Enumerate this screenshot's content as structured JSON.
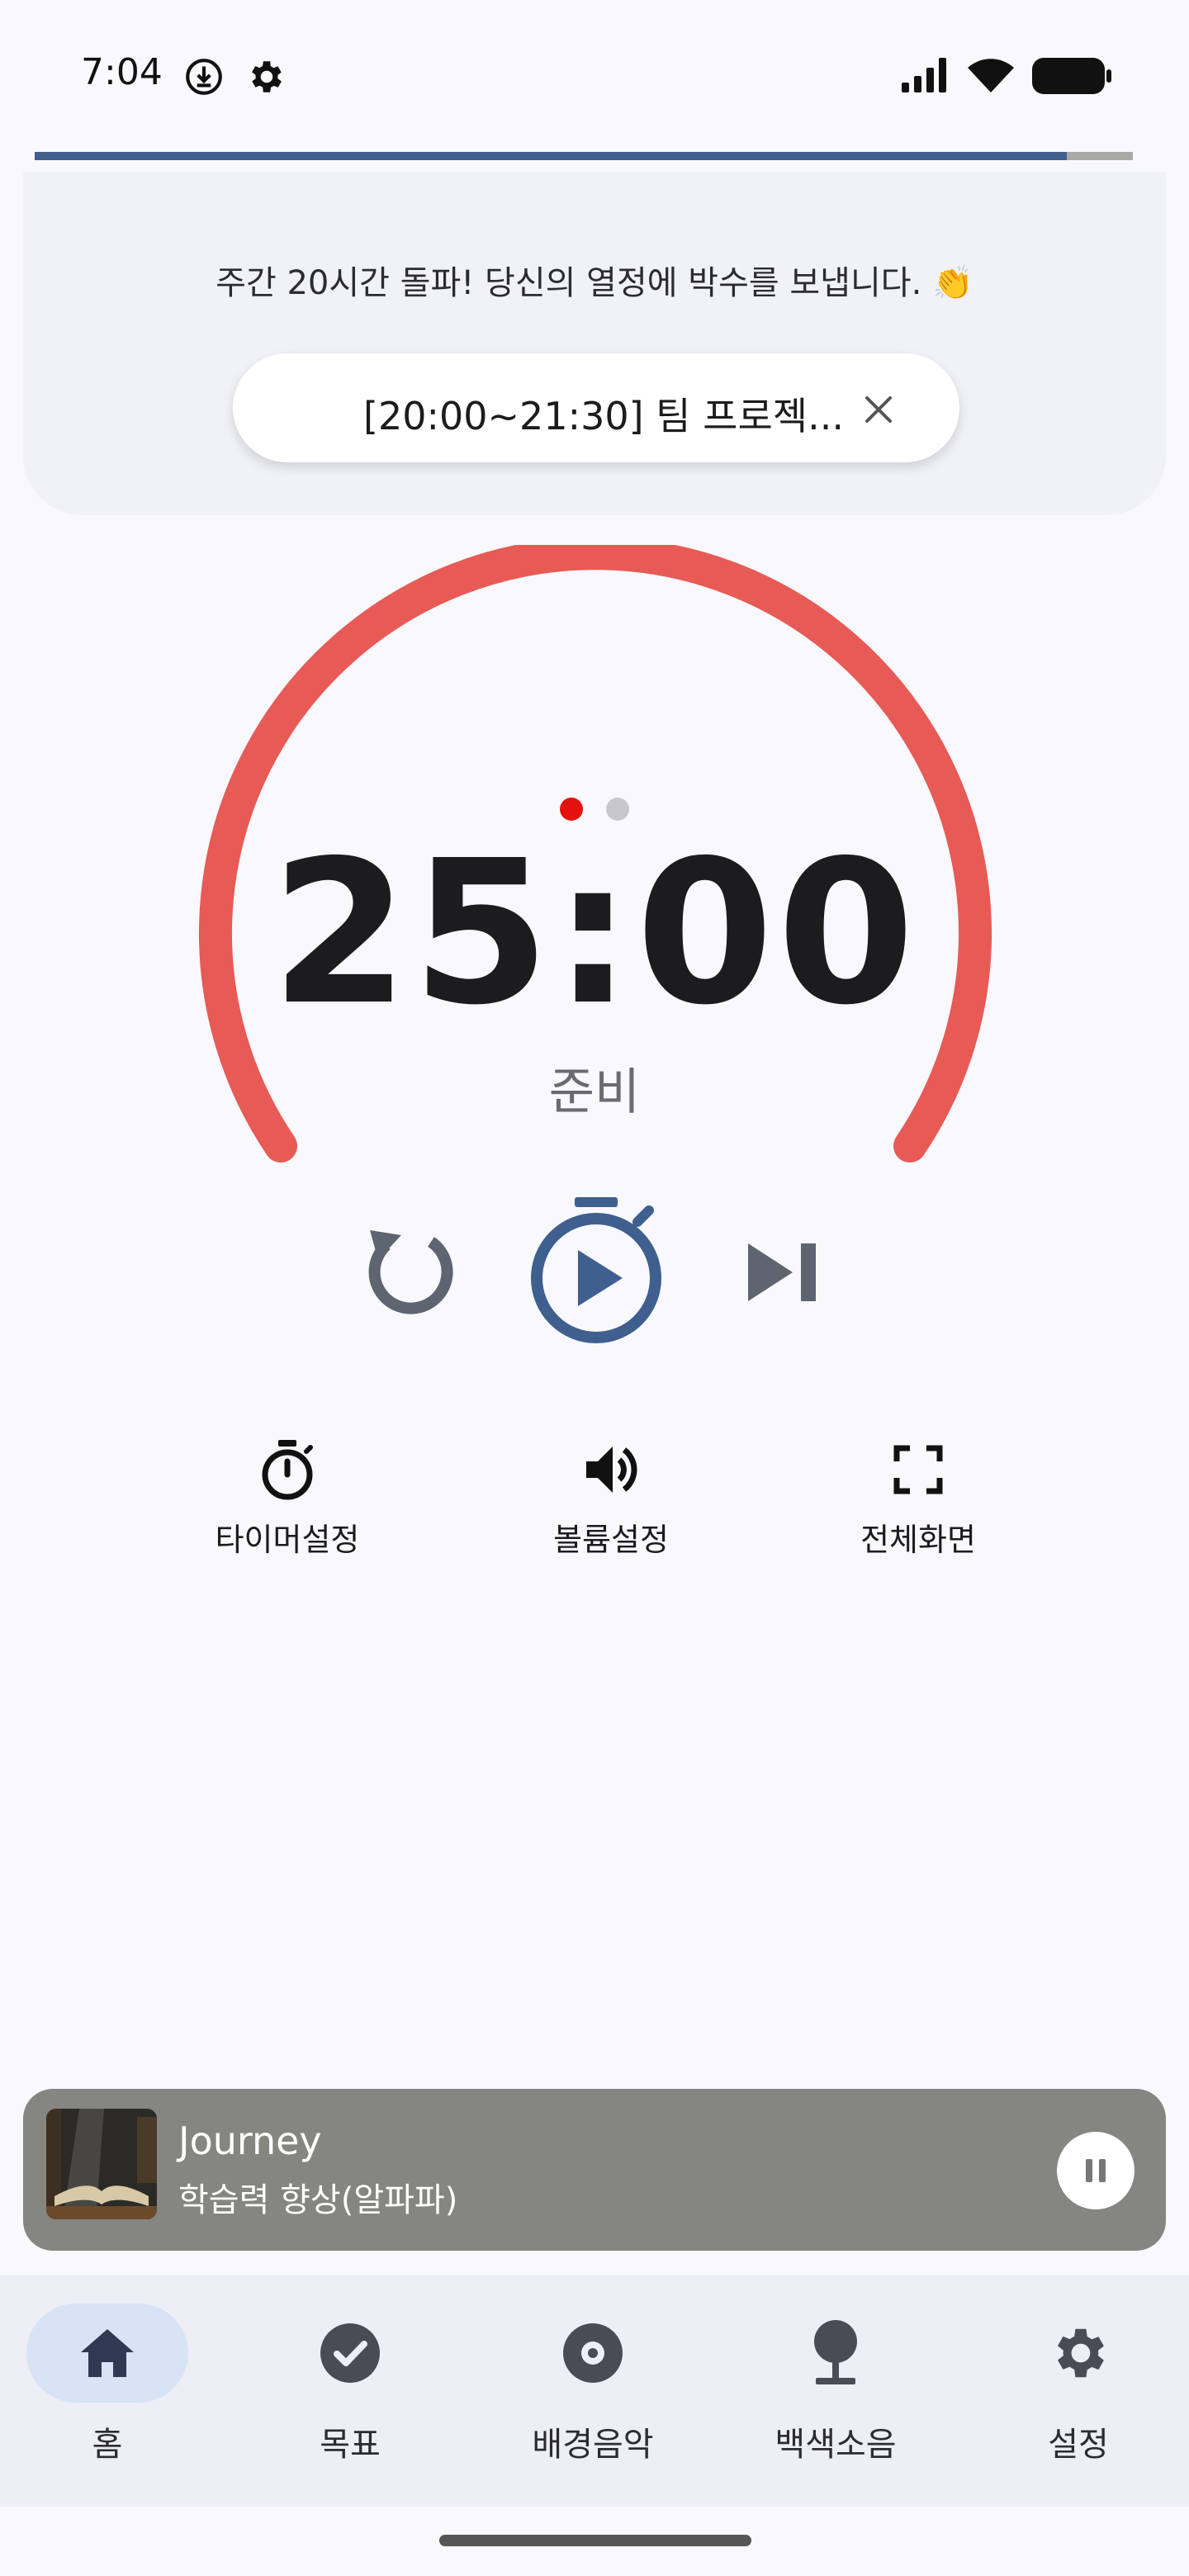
{
  "status_bar": {
    "time": "7:04",
    "icons": [
      "download-circle-icon",
      "gear-icon",
      "signal-icon",
      "wifi-icon",
      "battery-icon"
    ]
  },
  "banner": {
    "message": "주간 20시간 돌파! 당신의 열정에 박수를 보냅니다. 👏",
    "schedule_chip": "[20:00~21:30] 팀 프로젝..."
  },
  "timer": {
    "time": "25:00",
    "status": "준비",
    "ring_color": "#e85a55",
    "page_dots": {
      "count": 2,
      "active_index": 0,
      "active_color": "#e4120e"
    }
  },
  "controls": {
    "reset_icon": "replay-icon",
    "play_icon": "stopwatch-play-icon",
    "skip_icon": "skip-next-icon",
    "accent": "#3f5f8f"
  },
  "quick_actions": {
    "timer_label": "타이머설정",
    "volume_label": "볼륨설정",
    "fullscreen_label": "전체화면"
  },
  "player": {
    "title": "Journey",
    "subtitle": "학습력 향상(알파파)",
    "progress": 0.94
  },
  "nav": {
    "home": "홈",
    "goals": "목표",
    "music": "배경음악",
    "noise": "백색소음",
    "settings": "설정",
    "active": "home"
  }
}
